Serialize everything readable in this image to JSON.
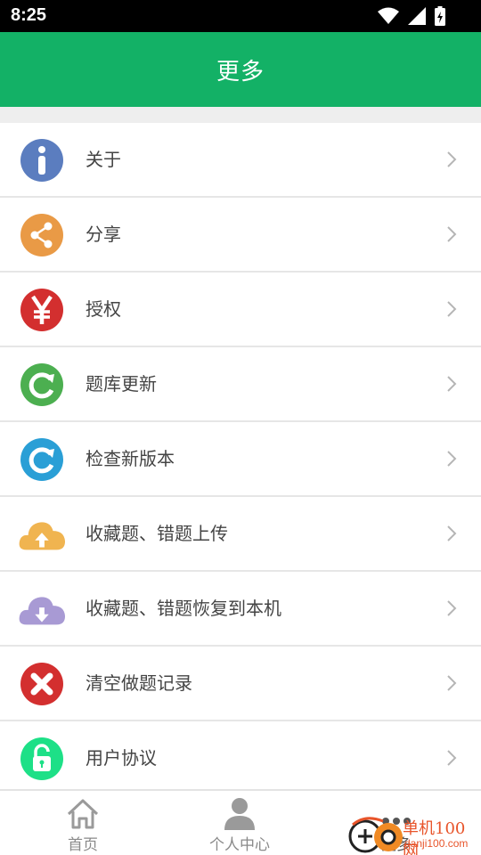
{
  "status_bar": {
    "time": "8:25"
  },
  "header": {
    "title": "更多"
  },
  "menu": [
    {
      "label": "关于",
      "icon": "info-icon",
      "color": "#5b7dbf"
    },
    {
      "label": "分享",
      "icon": "share-icon",
      "color": "#e99a46"
    },
    {
      "label": "授权",
      "icon": "yen-icon",
      "color": "#d32f2f"
    },
    {
      "label": "题库更新",
      "icon": "refresh-icon",
      "color": "#4caf50"
    },
    {
      "label": "检查新版本",
      "icon": "update-icon",
      "color": "#2a9fd6"
    },
    {
      "label": "收藏题、错题上传",
      "icon": "cloud-upload-icon",
      "color": "#f0b450"
    },
    {
      "label": "收藏题、错题恢复到本机",
      "icon": "cloud-download-icon",
      "color": "#a89ad4"
    },
    {
      "label": "清空做题记录",
      "icon": "clear-icon",
      "color": "#d32f2f"
    },
    {
      "label": "用户协议",
      "icon": "lock-icon",
      "color": "#1de087"
    }
  ],
  "tabs": [
    {
      "label": "首页",
      "icon": "home-icon"
    },
    {
      "label": "个人中心",
      "icon": "person-icon"
    },
    {
      "label": "更多",
      "icon": "more-icon"
    }
  ],
  "watermark": {
    "text": "单机100网",
    "url": "danji100.com"
  },
  "colors": {
    "accent": "#13b166",
    "text": "#444444",
    "divider": "#e6e6e6"
  }
}
